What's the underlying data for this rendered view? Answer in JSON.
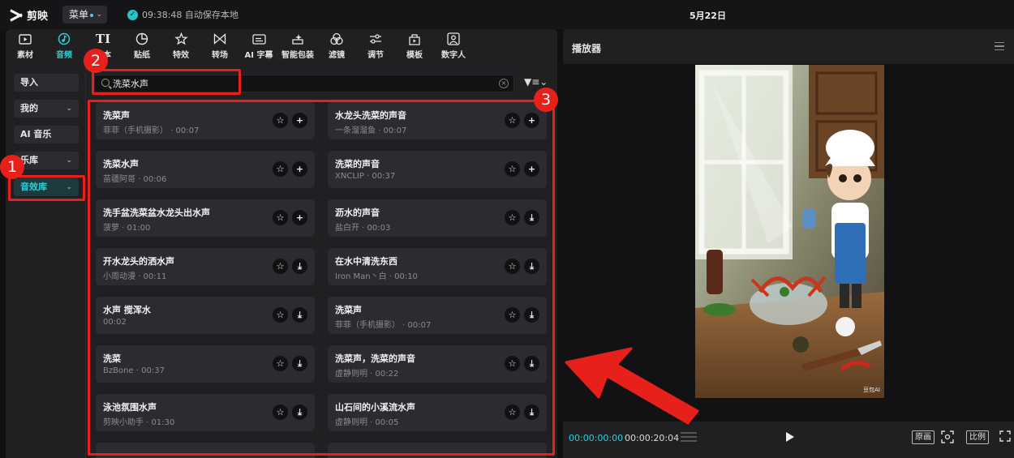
{
  "app": {
    "name": "剪映",
    "menu_label": "菜单",
    "save_status": "09:38:48 自动保存本地",
    "date": "5月22日"
  },
  "toolbar": [
    {
      "label": "素材",
      "icon": "media-icon"
    },
    {
      "label": "音频",
      "icon": "audio-icon",
      "active": true
    },
    {
      "label": "文本",
      "icon": "text-icon"
    },
    {
      "label": "贴纸",
      "icon": "sticker-icon"
    },
    {
      "label": "特效",
      "icon": "effects-icon"
    },
    {
      "label": "转场",
      "icon": "transition-icon"
    },
    {
      "label": "AI 字幕",
      "icon": "ai-subtitle-icon"
    },
    {
      "label": "智能包装",
      "icon": "smart-pack-icon"
    },
    {
      "label": "滤镜",
      "icon": "filter-icon"
    },
    {
      "label": "调节",
      "icon": "adjust-icon"
    },
    {
      "label": "模板",
      "icon": "template-icon"
    },
    {
      "label": "数字人",
      "icon": "avatar-icon"
    }
  ],
  "sidenav": [
    {
      "label": "导入"
    },
    {
      "label": "我的"
    },
    {
      "label": "AI 音乐"
    },
    {
      "label": "乐库"
    },
    {
      "label": "音效库",
      "active": true
    }
  ],
  "search": {
    "value": "洗菜水声",
    "clear_icon": "clear-icon"
  },
  "sound_effects": [
    {
      "title": "洗菜声",
      "meta": "菲菲（手机摄影） · 00:07",
      "action": "add"
    },
    {
      "title": "水龙头洗菜的声音",
      "meta": "一条溜溜鱼 · 00:07",
      "action": "add"
    },
    {
      "title": "洗菜水声",
      "meta": "苗疆阿哥 · 00:06",
      "action": "add"
    },
    {
      "title": "洗菜的声音",
      "meta": "XNCLIP · 00:37",
      "action": "add"
    },
    {
      "title": "洗手盆洗菜盆水龙头出水声",
      "meta": "菠萝 · 01:00",
      "action": "add"
    },
    {
      "title": "沥水的声音",
      "meta": "盐白开 · 00:03",
      "action": "download"
    },
    {
      "title": "开水龙头的洒水声",
      "meta": "小周动漫 · 00:11",
      "action": "download"
    },
    {
      "title": "在水中清洗东西",
      "meta": "Iron Man丶白 · 00:10",
      "action": "download"
    },
    {
      "title": "水声 搅浑水",
      "meta": "00:02",
      "action": "download"
    },
    {
      "title": "洗菜声",
      "meta": "菲菲（手机摄影） · 00:07",
      "action": "download"
    },
    {
      "title": "洗菜",
      "meta": "BzBone · 00:37",
      "action": "download"
    },
    {
      "title": "洗菜声，洗菜的声音",
      "meta": "虚静则明 · 00:22",
      "action": "download"
    },
    {
      "title": "泳池氛围水声",
      "meta": "剪映小助手 · 01:30",
      "action": "download"
    },
    {
      "title": "山石间的小溪流水声",
      "meta": "虚静则明 · 00:05",
      "action": "download"
    }
  ],
  "player": {
    "title": "播放器",
    "current_time": "00:00:00:00",
    "total_time": "00:00:20:04",
    "watermark": "豆包AI",
    "buttons": {
      "original": "原画",
      "ratio": "比例"
    }
  },
  "annotations": {
    "badge1": "1",
    "badge2": "2",
    "badge3": "3"
  },
  "colors": {
    "accent": "#2bd1d8",
    "annotation": "#e8201b",
    "panel": "#202023",
    "card": "#2c2c30"
  }
}
